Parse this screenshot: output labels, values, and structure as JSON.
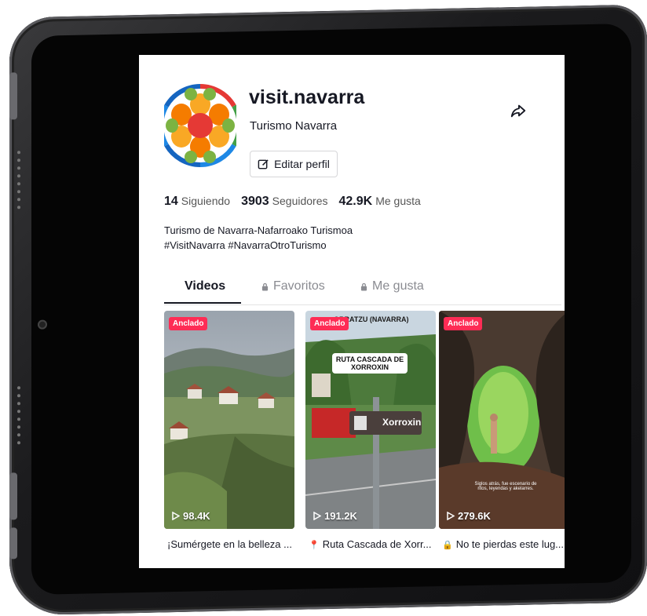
{
  "profile": {
    "username": "visit.navarra",
    "nickname": "Turismo Navarra",
    "edit_button": "Editar perfil",
    "stats": {
      "following_count": "14",
      "following_label": "Siguiendo",
      "followers_count": "3903",
      "followers_label": "Seguidores",
      "likes_count": "42.9K",
      "likes_label": "Me gusta"
    },
    "bio_line1": "Turismo de Navarra-Nafarroako Turismoa",
    "bio_line2": "#VisitNavarra #NavarraOtroTurismo"
  },
  "tabs": [
    {
      "label": "Videos",
      "active": true
    },
    {
      "label": "Favoritos",
      "icon": "lock-icon"
    },
    {
      "label": "Me gusta",
      "icon": "lock-icon"
    }
  ],
  "videos": [
    {
      "badge": "Anclado",
      "views": "98.4K",
      "caption": "¡Sumérgete en la belleza ..."
    },
    {
      "badge": "Anclado",
      "views": "191.2K",
      "caption": "Ruta Cascada de Xorr...",
      "caption_icon": "pin-icon",
      "overlay_top": "ORRATZU (NAVARRA)",
      "overlay_label_line1": "RUTA CASCADA DE",
      "overlay_label_line2": "XORROXIN",
      "sign_text": "Xorroxin"
    },
    {
      "badge": "Anclado",
      "views": "279.6K",
      "caption": "No te pierdas este lug...",
      "caption_icon": "lock-icon",
      "overlay_line1": "Siglos atrás, fue escenario de",
      "overlay_line2": "ritos, leyendas y akelarres."
    }
  ],
  "colors": {
    "accent": "#fe2c55",
    "text": "#161823"
  }
}
